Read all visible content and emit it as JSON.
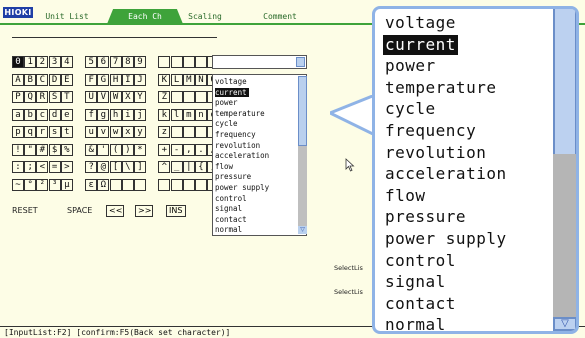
{
  "logo": "HIOKI",
  "tabs": [
    {
      "label": "Unit List",
      "active": false
    },
    {
      "label": "Each Ch",
      "active": true
    },
    {
      "label": "Scaling",
      "active": false
    },
    {
      "label": "Comment",
      "active": false
    }
  ],
  "char_rows": [
    [
      "0",
      "1",
      "2",
      "3",
      "4",
      " ",
      "5",
      "6",
      "7",
      "8",
      "9",
      " ",
      " ",
      " ",
      " ",
      " ",
      " "
    ],
    [
      "A",
      "B",
      "C",
      "D",
      "E",
      " ",
      "F",
      "G",
      "H",
      "I",
      "J",
      " ",
      "K",
      "L",
      "M",
      "N",
      "O"
    ],
    [
      "P",
      "Q",
      "R",
      "S",
      "T",
      " ",
      "U",
      "V",
      "W",
      "X",
      "Y",
      " ",
      "Z",
      " ",
      " ",
      " ",
      " "
    ],
    [
      "a",
      "b",
      "c",
      "d",
      "e",
      " ",
      "f",
      "g",
      "h",
      "i",
      "j",
      " ",
      "k",
      "l",
      "m",
      "n",
      "o"
    ],
    [
      "p",
      "q",
      "r",
      "s",
      "t",
      " ",
      "u",
      "v",
      "w",
      "x",
      "y",
      " ",
      "z",
      " ",
      " ",
      " ",
      " "
    ],
    [
      "!",
      "\"",
      "#",
      "$",
      "%",
      " ",
      "&",
      "'",
      "(",
      ")",
      "*",
      " ",
      "+",
      "-",
      ",",
      ".",
      "/"
    ],
    [
      ":",
      ";",
      "<",
      "=",
      ">",
      " ",
      "?",
      "@",
      "[",
      "\\",
      "]",
      " ",
      "^",
      "_",
      "|",
      "{",
      "}"
    ],
    [
      "~",
      "°",
      "²",
      "³",
      "µ",
      " ",
      "ε",
      "Ω",
      " ",
      " ",
      " ",
      " ",
      " ",
      " ",
      " ",
      " ",
      " "
    ]
  ],
  "buttons": {
    "reset": "RESET",
    "space": "SPACE",
    "prev": "<<",
    "next": ">>",
    "ins": "INS"
  },
  "list_items": [
    "voltage",
    "current",
    "power",
    "temperature",
    "cycle",
    "frequency",
    "revolution",
    "acceleration",
    "flow",
    "pressure",
    "power supply",
    "control",
    "signal",
    "contact",
    "normal"
  ],
  "selected_item": "current",
  "side_labels": {
    "label1": "SelectLis",
    "label2": "SelectLis"
  },
  "status_text": "[InputList:F2] [confirm:F5(Back set character)]",
  "colors": {
    "accent": "#3ea33a",
    "background": "#fdfde6",
    "scroll_thumb": "#bcd1f0",
    "callout": "#8fb3e6"
  }
}
